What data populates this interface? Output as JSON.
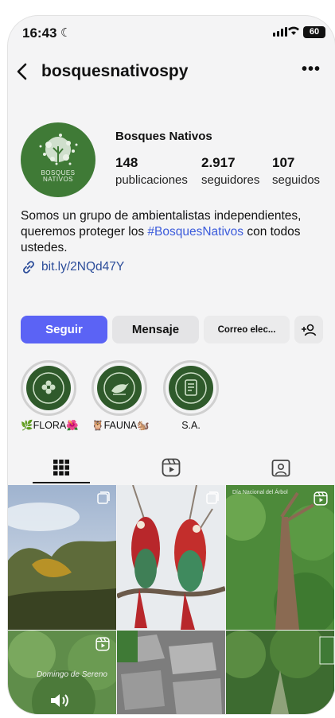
{
  "status_bar": {
    "time": "16:43",
    "battery": "60"
  },
  "header": {
    "username": "bosquesnativospy"
  },
  "profile": {
    "display_name": "Bosques Nativos",
    "avatar_text": "BOSQUES\nNATIVOS",
    "stats": [
      {
        "value": "148",
        "label": "publicaciones"
      },
      {
        "value": "2.917",
        "label": "seguidores"
      },
      {
        "value": "107",
        "label": "seguidos"
      }
    ],
    "bio_part1": "Somos un grupo de ambientalistas independientes, queremos proteger los ",
    "bio_hashtag": "#BosquesNativos",
    "bio_part2": " con todos ustedes.",
    "link": "bit.ly/2NQd47Y"
  },
  "buttons": {
    "follow": "Seguir",
    "message": "Mensaje",
    "email": "Correo elec..."
  },
  "highlights": [
    {
      "label": "🌿FLORA🌺",
      "icon": "flower-icon"
    },
    {
      "label": "🦉FAUNA🐿️",
      "icon": "bird-icon"
    },
    {
      "label": "S.A.",
      "icon": "document-icon"
    }
  ],
  "tabs": [
    "grid-icon",
    "reels-icon",
    "tagged-icon"
  ],
  "posts": [
    {
      "caption": ""
    },
    {
      "caption": ""
    },
    {
      "caption": "Día Nacional del Árbol"
    },
    {
      "caption": "Domingo de Sereno"
    },
    {
      "caption": ""
    },
    {
      "caption": ""
    }
  ],
  "colors": {
    "accent": "#5b63f5",
    "brand_green": "#3f7a36",
    "hashtag": "#3b5bdb"
  }
}
